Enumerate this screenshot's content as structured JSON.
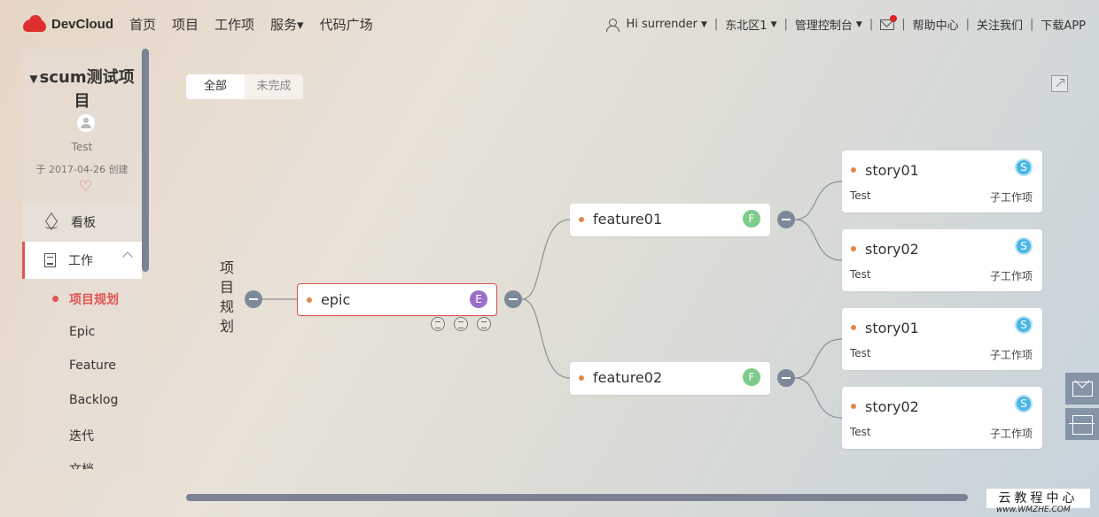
{
  "brand": {
    "name": "DevCloud",
    "color": "#e02f2f"
  },
  "nav": {
    "items": [
      "首页",
      "项目",
      "工作项",
      "服务▾",
      "代码广场"
    ]
  },
  "header_right": {
    "greeting": "Hi  surrender",
    "region": "东北区1",
    "console": "管理控制台",
    "help": "帮助中心",
    "follow": "关注我们",
    "download": "下载APP"
  },
  "sidebar": {
    "project_title": "scum测试项目",
    "owner": "Test",
    "created": "于 2017-04-26 创建",
    "board": "看板",
    "work": "工作",
    "sub_items": [
      "项目规划",
      "Epic",
      "Feature",
      "Backlog",
      "迭代",
      "文档"
    ]
  },
  "tabs": [
    "全部",
    "未完成"
  ],
  "tree": {
    "root": "项目规划",
    "epic": {
      "title": "epic",
      "badge": "E"
    },
    "features": [
      {
        "title": "feature01",
        "badge": "F"
      },
      {
        "title": "feature02",
        "badge": "F"
      }
    ],
    "stories": [
      {
        "title": "story01",
        "badge": "S",
        "owner": "Test",
        "kind": "子工作项"
      },
      {
        "title": "story02",
        "badge": "S",
        "owner": "Test",
        "kind": "子工作项"
      },
      {
        "title": "story01",
        "badge": "S",
        "owner": "Test",
        "kind": "子工作项"
      },
      {
        "title": "story02",
        "badge": "S",
        "owner": "Test",
        "kind": "子工作项"
      }
    ]
  },
  "watermark": {
    "title": "云教程中心",
    "url": "www.WMZHE.COM"
  },
  "colors": {
    "accent": "#e05555",
    "collapse": "#7d8898",
    "epic_badge": "#9b6fc9",
    "feature_badge": "#7dcc8a",
    "story_badge": "#4ab6e4"
  }
}
